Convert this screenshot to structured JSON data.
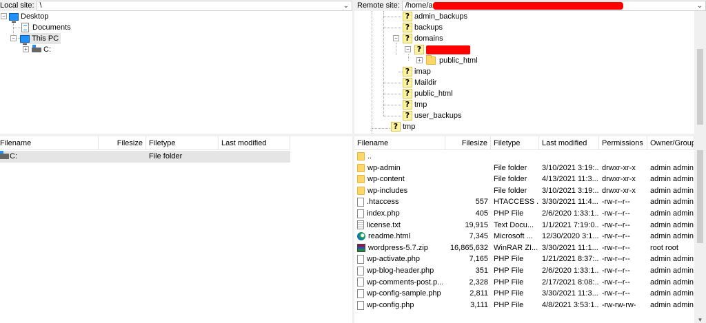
{
  "local_site": {
    "label": "Local site:",
    "path": "\\"
  },
  "remote_site": {
    "label": "Remote site:",
    "path": "/home/a"
  },
  "local_tree": {
    "desktop": "Desktop",
    "documents": "Documents",
    "this_pc": "This PC",
    "c_drive": "C:"
  },
  "remote_tree": {
    "admin_backups": "admin_backups",
    "backups": "backups",
    "domains": "domains",
    "public_html_sub": "public_html",
    "imap": "imap",
    "maildir": "Maildir",
    "public_html": "public_html",
    "tmp_inner": "tmp",
    "user_backups": "user_backups",
    "tmp": "tmp"
  },
  "local_list": {
    "columns": [
      "Filename",
      "Filesize",
      "Filetype",
      "Last modified"
    ],
    "rows": [
      {
        "name": "C:",
        "size": "",
        "type": "File folder",
        "modified": ""
      }
    ]
  },
  "remote_list": {
    "columns": [
      "Filename",
      "Filesize",
      "Filetype",
      "Last modified",
      "Permissions",
      "Owner/Group"
    ],
    "rows": [
      {
        "icon": "folder",
        "name": "..",
        "size": "",
        "type": "",
        "modified": "",
        "perm": "",
        "owner": ""
      },
      {
        "icon": "folder",
        "name": "wp-admin",
        "size": "",
        "type": "File folder",
        "modified": "3/10/2021 3:19:...",
        "perm": "drwxr-xr-x",
        "owner": "admin admin"
      },
      {
        "icon": "folder",
        "name": "wp-content",
        "size": "",
        "type": "File folder",
        "modified": "4/13/2021 11:3...",
        "perm": "drwxr-xr-x",
        "owner": "admin admin"
      },
      {
        "icon": "folder",
        "name": "wp-includes",
        "size": "",
        "type": "File folder",
        "modified": "3/10/2021 3:19:...",
        "perm": "drwxr-xr-x",
        "owner": "admin admin"
      },
      {
        "icon": "file",
        "name": ".htaccess",
        "size": "557",
        "type": "HTACCESS ...",
        "modified": "3/30/2021 11:4...",
        "perm": "-rw-r--r--",
        "owner": "admin admin"
      },
      {
        "icon": "file",
        "name": "index.php",
        "size": "405",
        "type": "PHP File",
        "modified": "2/6/2020 1:33:1...",
        "perm": "-rw-r--r--",
        "owner": "admin admin"
      },
      {
        "icon": "txt",
        "name": "license.txt",
        "size": "19,915",
        "type": "Text Docu...",
        "modified": "1/1/2021 7:19:0...",
        "perm": "-rw-r--r--",
        "owner": "admin admin"
      },
      {
        "icon": "edge",
        "name": "readme.html",
        "size": "7,345",
        "type": "Microsoft ...",
        "modified": "12/30/2020 3:1...",
        "perm": "-rw-r--r--",
        "owner": "admin admin"
      },
      {
        "icon": "rar",
        "name": "wordpress-5.7.zip",
        "size": "16,865,632",
        "type": "WinRAR ZI...",
        "modified": "3/30/2021 11:1...",
        "perm": "-rw-r--r--",
        "owner": "root root"
      },
      {
        "icon": "file",
        "name": "wp-activate.php",
        "size": "7,165",
        "type": "PHP File",
        "modified": "1/21/2021 8:37:...",
        "perm": "-rw-r--r--",
        "owner": "admin admin"
      },
      {
        "icon": "file",
        "name": "wp-blog-header.php",
        "size": "351",
        "type": "PHP File",
        "modified": "2/6/2020 1:33:1...",
        "perm": "-rw-r--r--",
        "owner": "admin admin"
      },
      {
        "icon": "file",
        "name": "wp-comments-post.p...",
        "size": "2,328",
        "type": "PHP File",
        "modified": "2/17/2021 8:08:...",
        "perm": "-rw-r--r--",
        "owner": "admin admin"
      },
      {
        "icon": "file",
        "name": "wp-config-sample.php",
        "size": "2,811",
        "type": "PHP File",
        "modified": "3/30/2021 11:3...",
        "perm": "-rw-r--r--",
        "owner": "admin admin"
      },
      {
        "icon": "file",
        "name": "wp-config.php",
        "size": "3,111",
        "type": "PHP File",
        "modified": "4/8/2021 3:53:1...",
        "perm": "-rw-rw-rw-",
        "owner": "admin admin"
      }
    ]
  },
  "colors": {
    "selection": "#e5e5e5",
    "redaction": "#ff0000",
    "folder": "#ffd766"
  },
  "icons": [
    "folder-icon",
    "question-icon",
    "monitor-icon",
    "document-icon",
    "drive-icon",
    "file-icon",
    "text-file-icon",
    "edge-icon",
    "winrar-icon"
  ]
}
